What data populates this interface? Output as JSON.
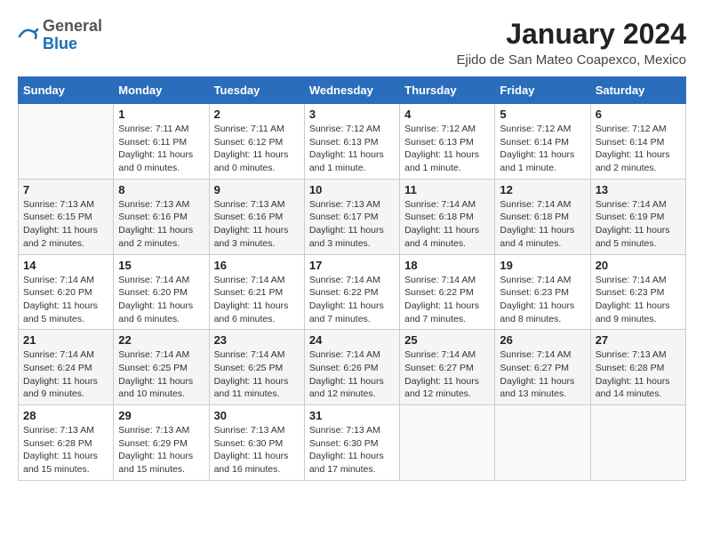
{
  "header": {
    "logo_general": "General",
    "logo_blue": "Blue",
    "month": "January 2024",
    "location": "Ejido de San Mateo Coapexco, Mexico"
  },
  "days_of_week": [
    "Sunday",
    "Monday",
    "Tuesday",
    "Wednesday",
    "Thursday",
    "Friday",
    "Saturday"
  ],
  "weeks": [
    [
      {
        "day": "",
        "sunrise": "",
        "sunset": "",
        "daylight": ""
      },
      {
        "day": "1",
        "sunrise": "Sunrise: 7:11 AM",
        "sunset": "Sunset: 6:11 PM",
        "daylight": "Daylight: 11 hours and 0 minutes."
      },
      {
        "day": "2",
        "sunrise": "Sunrise: 7:11 AM",
        "sunset": "Sunset: 6:12 PM",
        "daylight": "Daylight: 11 hours and 0 minutes."
      },
      {
        "day": "3",
        "sunrise": "Sunrise: 7:12 AM",
        "sunset": "Sunset: 6:13 PM",
        "daylight": "Daylight: 11 hours and 1 minute."
      },
      {
        "day": "4",
        "sunrise": "Sunrise: 7:12 AM",
        "sunset": "Sunset: 6:13 PM",
        "daylight": "Daylight: 11 hours and 1 minute."
      },
      {
        "day": "5",
        "sunrise": "Sunrise: 7:12 AM",
        "sunset": "Sunset: 6:14 PM",
        "daylight": "Daylight: 11 hours and 1 minute."
      },
      {
        "day": "6",
        "sunrise": "Sunrise: 7:12 AM",
        "sunset": "Sunset: 6:14 PM",
        "daylight": "Daylight: 11 hours and 2 minutes."
      }
    ],
    [
      {
        "day": "7",
        "sunrise": "Sunrise: 7:13 AM",
        "sunset": "Sunset: 6:15 PM",
        "daylight": "Daylight: 11 hours and 2 minutes."
      },
      {
        "day": "8",
        "sunrise": "Sunrise: 7:13 AM",
        "sunset": "Sunset: 6:16 PM",
        "daylight": "Daylight: 11 hours and 2 minutes."
      },
      {
        "day": "9",
        "sunrise": "Sunrise: 7:13 AM",
        "sunset": "Sunset: 6:16 PM",
        "daylight": "Daylight: 11 hours and 3 minutes."
      },
      {
        "day": "10",
        "sunrise": "Sunrise: 7:13 AM",
        "sunset": "Sunset: 6:17 PM",
        "daylight": "Daylight: 11 hours and 3 minutes."
      },
      {
        "day": "11",
        "sunrise": "Sunrise: 7:14 AM",
        "sunset": "Sunset: 6:18 PM",
        "daylight": "Daylight: 11 hours and 4 minutes."
      },
      {
        "day": "12",
        "sunrise": "Sunrise: 7:14 AM",
        "sunset": "Sunset: 6:18 PM",
        "daylight": "Daylight: 11 hours and 4 minutes."
      },
      {
        "day": "13",
        "sunrise": "Sunrise: 7:14 AM",
        "sunset": "Sunset: 6:19 PM",
        "daylight": "Daylight: 11 hours and 5 minutes."
      }
    ],
    [
      {
        "day": "14",
        "sunrise": "Sunrise: 7:14 AM",
        "sunset": "Sunset: 6:20 PM",
        "daylight": "Daylight: 11 hours and 5 minutes."
      },
      {
        "day": "15",
        "sunrise": "Sunrise: 7:14 AM",
        "sunset": "Sunset: 6:20 PM",
        "daylight": "Daylight: 11 hours and 6 minutes."
      },
      {
        "day": "16",
        "sunrise": "Sunrise: 7:14 AM",
        "sunset": "Sunset: 6:21 PM",
        "daylight": "Daylight: 11 hours and 6 minutes."
      },
      {
        "day": "17",
        "sunrise": "Sunrise: 7:14 AM",
        "sunset": "Sunset: 6:22 PM",
        "daylight": "Daylight: 11 hours and 7 minutes."
      },
      {
        "day": "18",
        "sunrise": "Sunrise: 7:14 AM",
        "sunset": "Sunset: 6:22 PM",
        "daylight": "Daylight: 11 hours and 7 minutes."
      },
      {
        "day": "19",
        "sunrise": "Sunrise: 7:14 AM",
        "sunset": "Sunset: 6:23 PM",
        "daylight": "Daylight: 11 hours and 8 minutes."
      },
      {
        "day": "20",
        "sunrise": "Sunrise: 7:14 AM",
        "sunset": "Sunset: 6:23 PM",
        "daylight": "Daylight: 11 hours and 9 minutes."
      }
    ],
    [
      {
        "day": "21",
        "sunrise": "Sunrise: 7:14 AM",
        "sunset": "Sunset: 6:24 PM",
        "daylight": "Daylight: 11 hours and 9 minutes."
      },
      {
        "day": "22",
        "sunrise": "Sunrise: 7:14 AM",
        "sunset": "Sunset: 6:25 PM",
        "daylight": "Daylight: 11 hours and 10 minutes."
      },
      {
        "day": "23",
        "sunrise": "Sunrise: 7:14 AM",
        "sunset": "Sunset: 6:25 PM",
        "daylight": "Daylight: 11 hours and 11 minutes."
      },
      {
        "day": "24",
        "sunrise": "Sunrise: 7:14 AM",
        "sunset": "Sunset: 6:26 PM",
        "daylight": "Daylight: 11 hours and 12 minutes."
      },
      {
        "day": "25",
        "sunrise": "Sunrise: 7:14 AM",
        "sunset": "Sunset: 6:27 PM",
        "daylight": "Daylight: 11 hours and 12 minutes."
      },
      {
        "day": "26",
        "sunrise": "Sunrise: 7:14 AM",
        "sunset": "Sunset: 6:27 PM",
        "daylight": "Daylight: 11 hours and 13 minutes."
      },
      {
        "day": "27",
        "sunrise": "Sunrise: 7:13 AM",
        "sunset": "Sunset: 6:28 PM",
        "daylight": "Daylight: 11 hours and 14 minutes."
      }
    ],
    [
      {
        "day": "28",
        "sunrise": "Sunrise: 7:13 AM",
        "sunset": "Sunset: 6:28 PM",
        "daylight": "Daylight: 11 hours and 15 minutes."
      },
      {
        "day": "29",
        "sunrise": "Sunrise: 7:13 AM",
        "sunset": "Sunset: 6:29 PM",
        "daylight": "Daylight: 11 hours and 15 minutes."
      },
      {
        "day": "30",
        "sunrise": "Sunrise: 7:13 AM",
        "sunset": "Sunset: 6:30 PM",
        "daylight": "Daylight: 11 hours and 16 minutes."
      },
      {
        "day": "31",
        "sunrise": "Sunrise: 7:13 AM",
        "sunset": "Sunset: 6:30 PM",
        "daylight": "Daylight: 11 hours and 17 minutes."
      },
      {
        "day": "",
        "sunrise": "",
        "sunset": "",
        "daylight": ""
      },
      {
        "day": "",
        "sunrise": "",
        "sunset": "",
        "daylight": ""
      },
      {
        "day": "",
        "sunrise": "",
        "sunset": "",
        "daylight": ""
      }
    ]
  ]
}
